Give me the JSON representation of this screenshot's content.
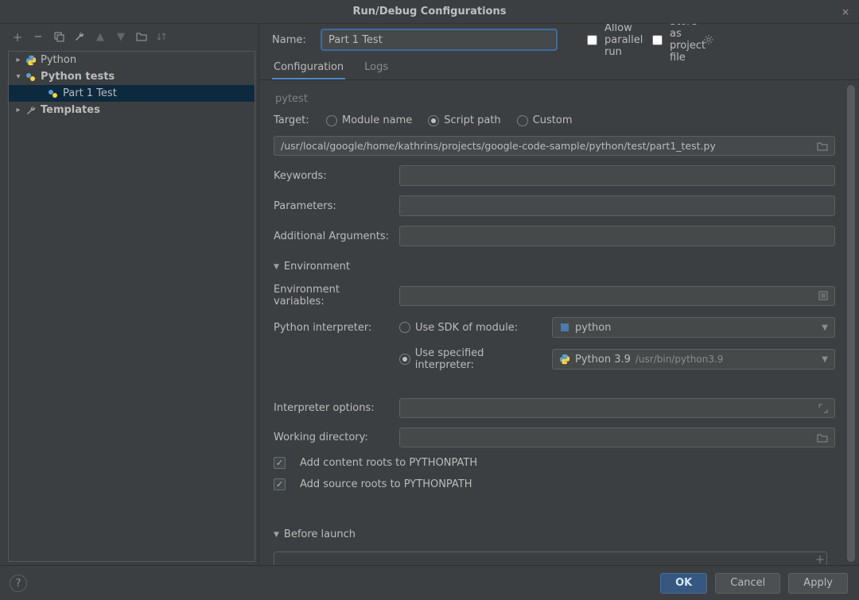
{
  "titlebar": {
    "title": "Run/Debug Configurations"
  },
  "toolbar": {
    "icons": [
      "add-icon",
      "remove-icon",
      "copy-icon",
      "wrench-icon",
      "up-icon",
      "down-icon",
      "folder-icon",
      "sort-icon"
    ]
  },
  "tree": {
    "items": [
      {
        "label": "Python",
        "level": 0,
        "expanded": true,
        "bold": false,
        "icon": "python-icon",
        "selected": false
      },
      {
        "label": "Python tests",
        "level": 0,
        "expanded": true,
        "bold": true,
        "icon": "pytest-icon",
        "selected": false
      },
      {
        "label": "Part 1 Test",
        "level": 2,
        "expanded": null,
        "bold": false,
        "icon": "pytest-icon",
        "selected": true
      },
      {
        "label": "Templates",
        "level": 0,
        "expanded": false,
        "bold": true,
        "icon": "wrench-icon",
        "selected": false
      }
    ]
  },
  "name_row": {
    "label": "Name:",
    "value": "Part 1 Test",
    "allow_parallel": "Allow parallel run",
    "allow_parallel_checked": false,
    "store_project": "Store as project file",
    "store_project_checked": false
  },
  "tabs": {
    "items": [
      "Configuration",
      "Logs"
    ],
    "active_index": 0
  },
  "form": {
    "pytest_label": "pytest",
    "target_label": "Target:",
    "target_options": [
      "Module name",
      "Script path",
      "Custom"
    ],
    "target_selected_index": 1,
    "target_path": "/usr/local/google/home/kathrins/projects/google-code-sample/python/test/part1_test.py",
    "keywords_label": "Keywords:",
    "keywords_value": "",
    "parameters_label": "Parameters:",
    "parameters_value": "",
    "add_args_label": "Additional Arguments:",
    "add_args_value": "",
    "env_section": "Environment",
    "env_vars_label": "Environment variables:",
    "env_vars_value": "",
    "py_interp_label": "Python interpreter:",
    "sdk_radio": "Use SDK of module:",
    "sdk_value": "python",
    "spec_radio": "Use specified interpreter:",
    "spec_value": "Python 3.9",
    "spec_path": "/usr/bin/python3.9",
    "interp_selected_index": 1,
    "interp_opts_label": "Interpreter options:",
    "workdir_label": "Working directory:",
    "add_content_roots": "Add content roots to PYTHONPATH",
    "add_content_checked": true,
    "add_source_roots": "Add source roots to PYTHONPATH",
    "add_source_checked": true,
    "before_launch_label": "Before launch"
  },
  "footer": {
    "ok": "OK",
    "cancel": "Cancel",
    "apply": "Apply"
  }
}
